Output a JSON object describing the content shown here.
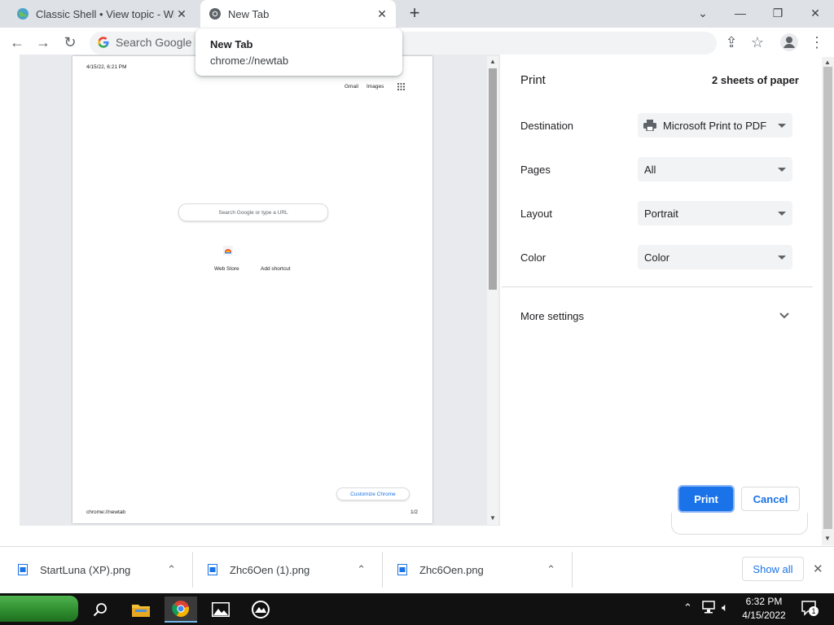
{
  "browser": {
    "tabs": [
      {
        "title": "Classic Shell • View topic - Wind"
      },
      {
        "title": "New Tab"
      }
    ],
    "omnibox_placeholder": "Search Google o",
    "hover_card": {
      "title": "New Tab",
      "url": "chrome://newtab"
    }
  },
  "preview": {
    "header_date": "4/15/22, 6:21 PM",
    "gmail": "Gmail",
    "images": "Images",
    "search_placeholder": "Search Google or type a URL",
    "shortcuts": [
      "Web Store",
      "Add shortcut"
    ],
    "customize": "Customize Chrome",
    "footer_url": "chrome://newtab",
    "page_number": "1/2"
  },
  "print": {
    "title": "Print",
    "sheets": "2 sheets of paper",
    "destination_label": "Destination",
    "destination_value": "Microsoft Print to PDF",
    "pages_label": "Pages",
    "pages_value": "All",
    "layout_label": "Layout",
    "layout_value": "Portrait",
    "color_label": "Color",
    "color_value": "Color",
    "more_settings": "More settings",
    "print_button": "Print",
    "cancel_button": "Cancel"
  },
  "downloads": {
    "items": [
      "StartLuna (XP).png",
      "Zhc6Oen (1).png",
      "Zhc6Oen.png"
    ],
    "show_all": "Show all"
  },
  "taskbar": {
    "time": "6:32 PM",
    "date": "4/15/2022",
    "notification_count": "1"
  },
  "colors": {
    "accent": "#1a73e8",
    "tabstrip": "#dee1e6",
    "taskbar": "#111111"
  }
}
